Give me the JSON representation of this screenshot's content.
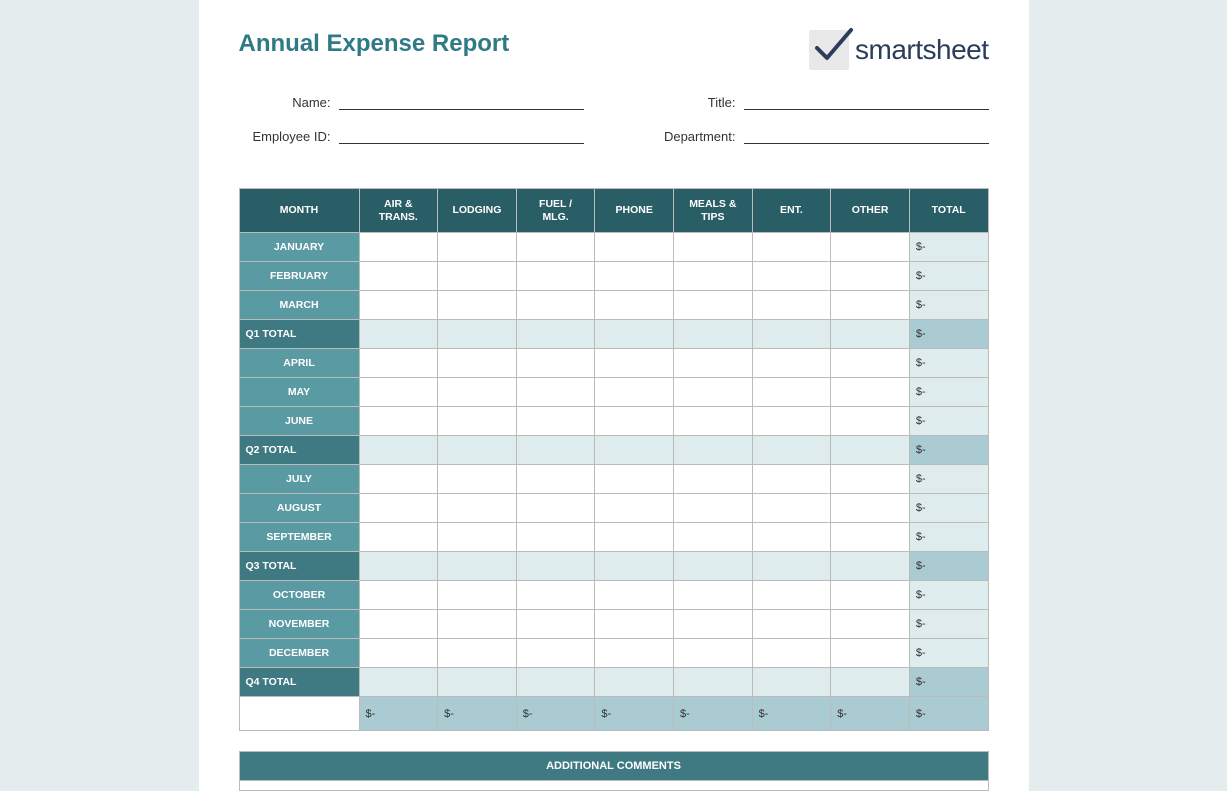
{
  "title": "Annual Expense Report",
  "logo_text": "smartsheet",
  "fields": {
    "name_label": "Name:",
    "name_value": "",
    "emp_id_label": "Employee ID:",
    "emp_id_value": "",
    "title_label": "Title:",
    "title_value": "",
    "dept_label": "Department:",
    "dept_value": ""
  },
  "columns": [
    "MONTH",
    "AIR & TRANS.",
    "LODGING",
    "FUEL / MLG.",
    "PHONE",
    "MEALS & TIPS",
    "ENT.",
    "OTHER",
    "TOTAL"
  ],
  "rows": [
    {
      "type": "month",
      "label": "JANUARY",
      "cells": [
        "",
        "",
        "",
        "",
        "",
        "",
        ""
      ],
      "total": "$-"
    },
    {
      "type": "month",
      "label": "FEBRUARY",
      "cells": [
        "",
        "",
        "",
        "",
        "",
        "",
        ""
      ],
      "total": "$-"
    },
    {
      "type": "month",
      "label": "MARCH",
      "cells": [
        "",
        "",
        "",
        "",
        "",
        "",
        ""
      ],
      "total": "$-"
    },
    {
      "type": "subtotal",
      "label": "Q1 TOTAL",
      "cells": [
        "",
        "",
        "",
        "",
        "",
        "",
        ""
      ],
      "total": "$-"
    },
    {
      "type": "month",
      "label": "APRIL",
      "cells": [
        "",
        "",
        "",
        "",
        "",
        "",
        ""
      ],
      "total": "$-"
    },
    {
      "type": "month",
      "label": "MAY",
      "cells": [
        "",
        "",
        "",
        "",
        "",
        "",
        ""
      ],
      "total": "$-"
    },
    {
      "type": "month",
      "label": "JUNE",
      "cells": [
        "",
        "",
        "",
        "",
        "",
        "",
        ""
      ],
      "total": "$-"
    },
    {
      "type": "subtotal",
      "label": "Q2 TOTAL",
      "cells": [
        "",
        "",
        "",
        "",
        "",
        "",
        ""
      ],
      "total": "$-"
    },
    {
      "type": "month",
      "label": "JULY",
      "cells": [
        "",
        "",
        "",
        "",
        "",
        "",
        ""
      ],
      "total": "$-"
    },
    {
      "type": "month",
      "label": "AUGUST",
      "cells": [
        "",
        "",
        "",
        "",
        "",
        "",
        ""
      ],
      "total": "$-"
    },
    {
      "type": "month",
      "label": "SEPTEMBER",
      "cells": [
        "",
        "",
        "",
        "",
        "",
        "",
        ""
      ],
      "total": "$-"
    },
    {
      "type": "subtotal",
      "label": "Q3 TOTAL",
      "cells": [
        "",
        "",
        "",
        "",
        "",
        "",
        ""
      ],
      "total": "$-"
    },
    {
      "type": "month",
      "label": "OCTOBER",
      "cells": [
        "",
        "",
        "",
        "",
        "",
        "",
        ""
      ],
      "total": "$-"
    },
    {
      "type": "month",
      "label": "NOVEMBER",
      "cells": [
        "",
        "",
        "",
        "",
        "",
        "",
        ""
      ],
      "total": "$-"
    },
    {
      "type": "month",
      "label": "DECEMBER",
      "cells": [
        "",
        "",
        "",
        "",
        "",
        "",
        ""
      ],
      "total": "$-"
    },
    {
      "type": "subtotal",
      "label": "Q4 TOTAL",
      "cells": [
        "",
        "",
        "",
        "",
        "",
        "",
        ""
      ],
      "total": "$-"
    }
  ],
  "grand": {
    "label": "",
    "cells": [
      "$-",
      "$-",
      "$-",
      "$-",
      "$-",
      "$-",
      "$-"
    ],
    "total": "$-"
  },
  "comments_label": "ADDITIONAL COMMENTS"
}
